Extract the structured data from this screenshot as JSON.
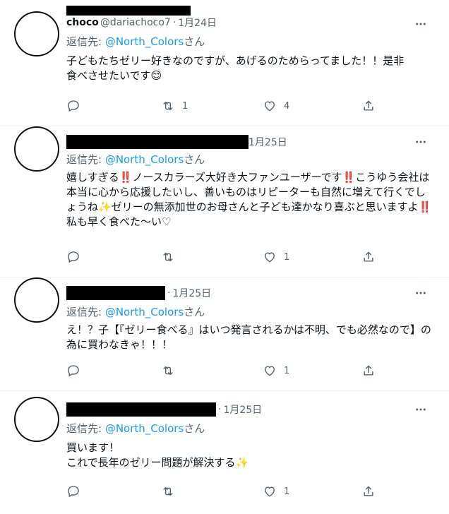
{
  "tweets": [
    {
      "name": "choco",
      "handle": "@dariachoco7",
      "dot": "·",
      "time": "1月24日",
      "reply_prefix": "返信先: ",
      "reply_mention": "@North_Colors",
      "reply_suffix": "さん",
      "text": "子どもたちゼリー好きなのですが、あげるのためらってました！！是非食べさせたいです😊",
      "retweets": "1",
      "likes": "4"
    },
    {
      "dot": "",
      "time": "1月25日",
      "reply_prefix": "返信先: ",
      "reply_mention": "@North_Colors",
      "reply_suffix": "さん",
      "text": "嬉しすぎる‼️ノースカラーズ大好き大ファンユーザーです‼️こうゆう会社は本当に心から応援したいし、善いものはリピーターも自然に増えて行くでしょうね✨ゼリーの無添加世のお母さんと子ども達かなり喜ぶと思いますよ‼️私も早く食べた〜い♡",
      "retweets": "",
      "likes": "1"
    },
    {
      "dot": "·",
      "time": "1月25日",
      "reply_prefix": "返信先: ",
      "reply_mention": "@North_Colors",
      "reply_suffix": "さん",
      "text": "え！？子【『ゼリー食べる』はいつ発言されるかは不明、でも必然なので】の為に買わなきゃ！！！",
      "retweets": "",
      "likes": "1"
    },
    {
      "dot": "·",
      "time": "1月25日",
      "reply_prefix": "返信先: ",
      "reply_mention": "@North_Colors",
      "reply_suffix": "さん",
      "text": "買います！\nこれで長年のゼリー問題が解決する✨",
      "retweets": "",
      "likes": "1"
    }
  ],
  "icons": {
    "reply": "reply-icon",
    "retweet": "retweet-icon",
    "like": "heart-icon",
    "share": "share-icon",
    "more": "more-icon"
  },
  "colors": {
    "link": "#1d9bf0",
    "muted": "#536471",
    "text": "#0f1419"
  }
}
